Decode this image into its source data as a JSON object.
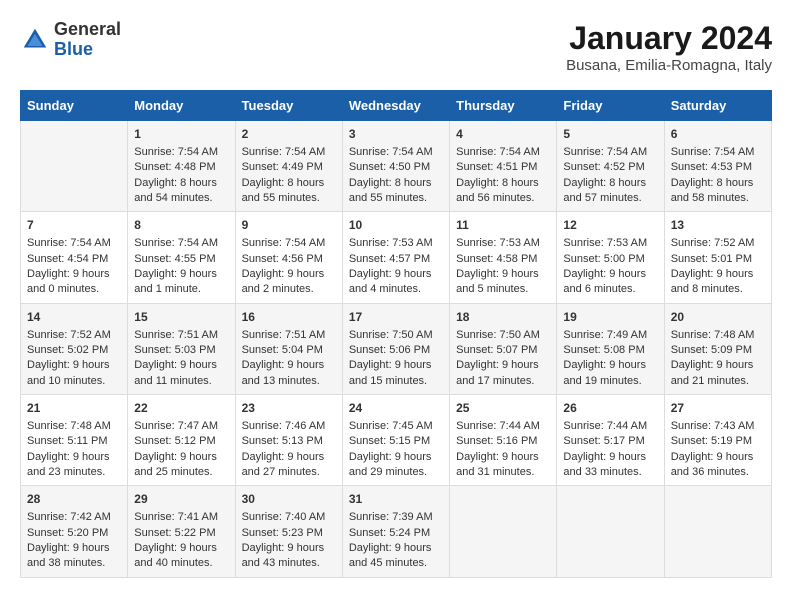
{
  "logo": {
    "general": "General",
    "blue": "Blue"
  },
  "title": "January 2024",
  "subtitle": "Busana, Emilia-Romagna, Italy",
  "headers": [
    "Sunday",
    "Monday",
    "Tuesday",
    "Wednesday",
    "Thursday",
    "Friday",
    "Saturday"
  ],
  "weeks": [
    [
      {
        "day": "",
        "content": ""
      },
      {
        "day": "1",
        "content": "Sunrise: 7:54 AM\nSunset: 4:48 PM\nDaylight: 8 hours\nand 54 minutes."
      },
      {
        "day": "2",
        "content": "Sunrise: 7:54 AM\nSunset: 4:49 PM\nDaylight: 8 hours\nand 55 minutes."
      },
      {
        "day": "3",
        "content": "Sunrise: 7:54 AM\nSunset: 4:50 PM\nDaylight: 8 hours\nand 55 minutes."
      },
      {
        "day": "4",
        "content": "Sunrise: 7:54 AM\nSunset: 4:51 PM\nDaylight: 8 hours\nand 56 minutes."
      },
      {
        "day": "5",
        "content": "Sunrise: 7:54 AM\nSunset: 4:52 PM\nDaylight: 8 hours\nand 57 minutes."
      },
      {
        "day": "6",
        "content": "Sunrise: 7:54 AM\nSunset: 4:53 PM\nDaylight: 8 hours\nand 58 minutes."
      }
    ],
    [
      {
        "day": "7",
        "content": "Sunrise: 7:54 AM\nSunset: 4:54 PM\nDaylight: 9 hours\nand 0 minutes."
      },
      {
        "day": "8",
        "content": "Sunrise: 7:54 AM\nSunset: 4:55 PM\nDaylight: 9 hours\nand 1 minute."
      },
      {
        "day": "9",
        "content": "Sunrise: 7:54 AM\nSunset: 4:56 PM\nDaylight: 9 hours\nand 2 minutes."
      },
      {
        "day": "10",
        "content": "Sunrise: 7:53 AM\nSunset: 4:57 PM\nDaylight: 9 hours\nand 4 minutes."
      },
      {
        "day": "11",
        "content": "Sunrise: 7:53 AM\nSunset: 4:58 PM\nDaylight: 9 hours\nand 5 minutes."
      },
      {
        "day": "12",
        "content": "Sunrise: 7:53 AM\nSunset: 5:00 PM\nDaylight: 9 hours\nand 6 minutes."
      },
      {
        "day": "13",
        "content": "Sunrise: 7:52 AM\nSunset: 5:01 PM\nDaylight: 9 hours\nand 8 minutes."
      }
    ],
    [
      {
        "day": "14",
        "content": "Sunrise: 7:52 AM\nSunset: 5:02 PM\nDaylight: 9 hours\nand 10 minutes."
      },
      {
        "day": "15",
        "content": "Sunrise: 7:51 AM\nSunset: 5:03 PM\nDaylight: 9 hours\nand 11 minutes."
      },
      {
        "day": "16",
        "content": "Sunrise: 7:51 AM\nSunset: 5:04 PM\nDaylight: 9 hours\nand 13 minutes."
      },
      {
        "day": "17",
        "content": "Sunrise: 7:50 AM\nSunset: 5:06 PM\nDaylight: 9 hours\nand 15 minutes."
      },
      {
        "day": "18",
        "content": "Sunrise: 7:50 AM\nSunset: 5:07 PM\nDaylight: 9 hours\nand 17 minutes."
      },
      {
        "day": "19",
        "content": "Sunrise: 7:49 AM\nSunset: 5:08 PM\nDaylight: 9 hours\nand 19 minutes."
      },
      {
        "day": "20",
        "content": "Sunrise: 7:48 AM\nSunset: 5:09 PM\nDaylight: 9 hours\nand 21 minutes."
      }
    ],
    [
      {
        "day": "21",
        "content": "Sunrise: 7:48 AM\nSunset: 5:11 PM\nDaylight: 9 hours\nand 23 minutes."
      },
      {
        "day": "22",
        "content": "Sunrise: 7:47 AM\nSunset: 5:12 PM\nDaylight: 9 hours\nand 25 minutes."
      },
      {
        "day": "23",
        "content": "Sunrise: 7:46 AM\nSunset: 5:13 PM\nDaylight: 9 hours\nand 27 minutes."
      },
      {
        "day": "24",
        "content": "Sunrise: 7:45 AM\nSunset: 5:15 PM\nDaylight: 9 hours\nand 29 minutes."
      },
      {
        "day": "25",
        "content": "Sunrise: 7:44 AM\nSunset: 5:16 PM\nDaylight: 9 hours\nand 31 minutes."
      },
      {
        "day": "26",
        "content": "Sunrise: 7:44 AM\nSunset: 5:17 PM\nDaylight: 9 hours\nand 33 minutes."
      },
      {
        "day": "27",
        "content": "Sunrise: 7:43 AM\nSunset: 5:19 PM\nDaylight: 9 hours\nand 36 minutes."
      }
    ],
    [
      {
        "day": "28",
        "content": "Sunrise: 7:42 AM\nSunset: 5:20 PM\nDaylight: 9 hours\nand 38 minutes."
      },
      {
        "day": "29",
        "content": "Sunrise: 7:41 AM\nSunset: 5:22 PM\nDaylight: 9 hours\nand 40 minutes."
      },
      {
        "day": "30",
        "content": "Sunrise: 7:40 AM\nSunset: 5:23 PM\nDaylight: 9 hours\nand 43 minutes."
      },
      {
        "day": "31",
        "content": "Sunrise: 7:39 AM\nSunset: 5:24 PM\nDaylight: 9 hours\nand 45 minutes."
      },
      {
        "day": "",
        "content": ""
      },
      {
        "day": "",
        "content": ""
      },
      {
        "day": "",
        "content": ""
      }
    ]
  ]
}
